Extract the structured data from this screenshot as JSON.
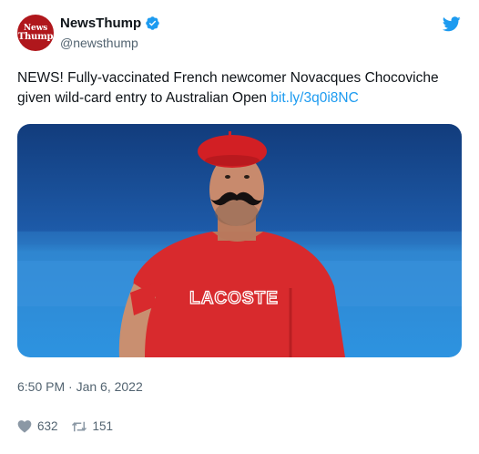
{
  "account": {
    "avatar_line1": "News",
    "avatar_line2": "Thump",
    "display_name": "NewsThump",
    "handle": "@newsthump",
    "verified_icon": "verified-badge-icon"
  },
  "tweet": {
    "text": "NEWS! Fully-vaccinated French newcomer Novacques Chocoviche given wild-card entry to Australian Open ",
    "link": "bit.ly/3q0i8NC",
    "image_shirt_text": "LACOSTE",
    "timestamp": "6:50 PM · Jan 6, 2022"
  },
  "engagement": {
    "likes": "632",
    "retweets": "151"
  },
  "icons": {
    "logo": "twitter-bird-icon",
    "like": "heart-icon",
    "retweet": "retweet-icon"
  },
  "colors": {
    "link": "#1d9bf0",
    "verified": "#1d9bf0",
    "avatar": "#b0171c",
    "muted": "#536471"
  }
}
